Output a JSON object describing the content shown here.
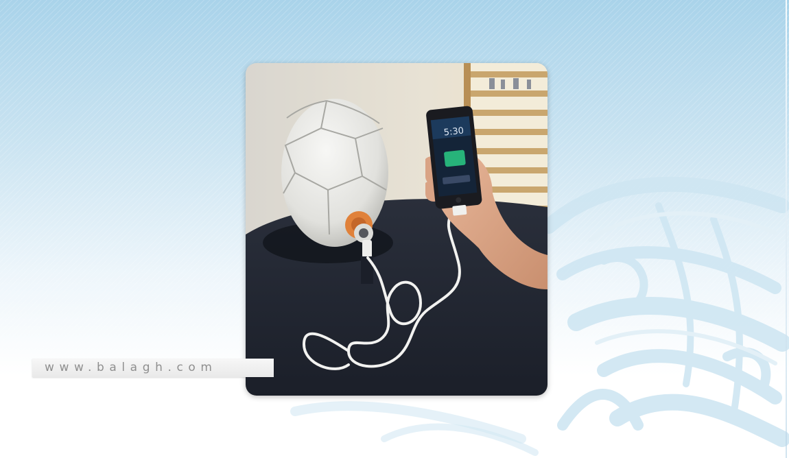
{
  "watermark": {
    "text": "www.balagh.com"
  },
  "photo": {
    "clock_text": "5:30",
    "subject": "soccer-ball-charging-phone"
  },
  "colors": {
    "background_top": "#a9d3ea",
    "background_bottom": "#ffffff",
    "calligraphy": "#c8e2f0",
    "watermark_text": "#8f8f8f",
    "watermark_bg": "#eeeeee"
  }
}
